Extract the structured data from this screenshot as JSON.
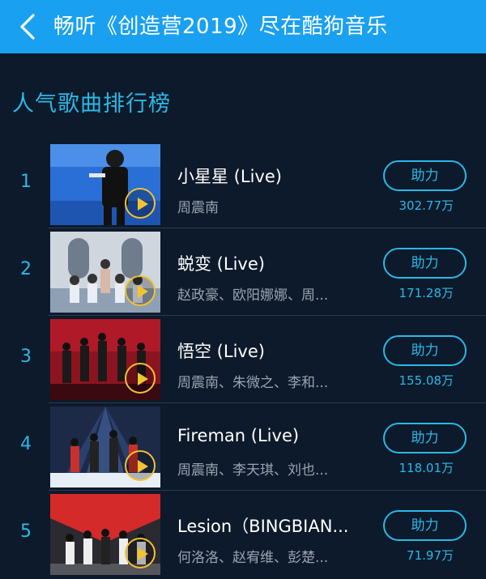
{
  "header": {
    "title": "畅听《创造营2019》尽在酷狗音乐",
    "back_icon": "chevron-left-icon"
  },
  "section": {
    "title": "人气歌曲排行榜"
  },
  "songs": [
    {
      "rank": "1",
      "title": "小星星 (Live)",
      "artist": "周震南",
      "button": "助力",
      "count": "302.77万"
    },
    {
      "rank": "2",
      "title": "蜕变 (Live)",
      "artist": "赵政豪、欧阳娜娜、周...",
      "button": "助力",
      "count": "171.28万"
    },
    {
      "rank": "3",
      "title": "悟空 (Live)",
      "artist": "周震南、朱微之、李和...",
      "button": "助力",
      "count": "155.08万"
    },
    {
      "rank": "4",
      "title": "Fireman (Live)",
      "artist": "周震南、李天琪、刘也...",
      "button": "助力",
      "count": "118.01万"
    },
    {
      "rank": "5",
      "title": "Lesion（BINGBIAN...",
      "artist": "何洛洛、赵宥维、彭楚...",
      "button": "助力",
      "count": "71.97万"
    }
  ],
  "colors": {
    "header_bg": "#1aa0f0",
    "page_bg": "#0d1a2b",
    "accent": "#2ab8e6",
    "play_icon": "#f2c230"
  }
}
